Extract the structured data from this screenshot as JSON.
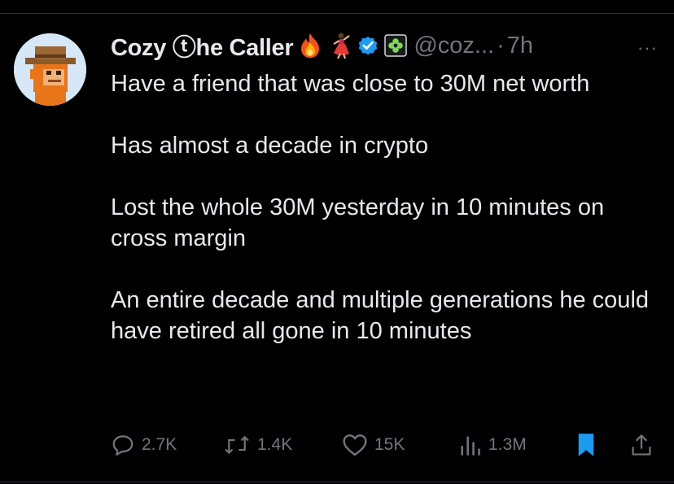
{
  "tweet": {
    "author": {
      "display_name": "Cozy ⓣhe Caller",
      "handle": "@coz...",
      "avatar": "pixel-cowboy-ape-avatar",
      "badges": [
        "fire-emoji",
        "dancer-emoji",
        "verified-badge",
        "flower-badge"
      ]
    },
    "time": "7h",
    "dot": "·",
    "more": "···",
    "text": {
      "p1": "Have a friend that was close to 30M net worth",
      "p2": "Has almost a decade in crypto",
      "p3": "Lost the whole 30M yesterday in 10 minutes on cross margin",
      "p4": "An entire decade and multiple generations he could have retired all gone in 10 minutes"
    },
    "stats": {
      "replies": "2.7K",
      "reposts": "1.4K",
      "likes": "15K",
      "views": "1.3M"
    },
    "colors": {
      "background": "#000000",
      "text": "#e7e9ea",
      "muted": "#71767b",
      "verified": "#1d9bf0",
      "bookmark": "#1d9bf0"
    }
  }
}
